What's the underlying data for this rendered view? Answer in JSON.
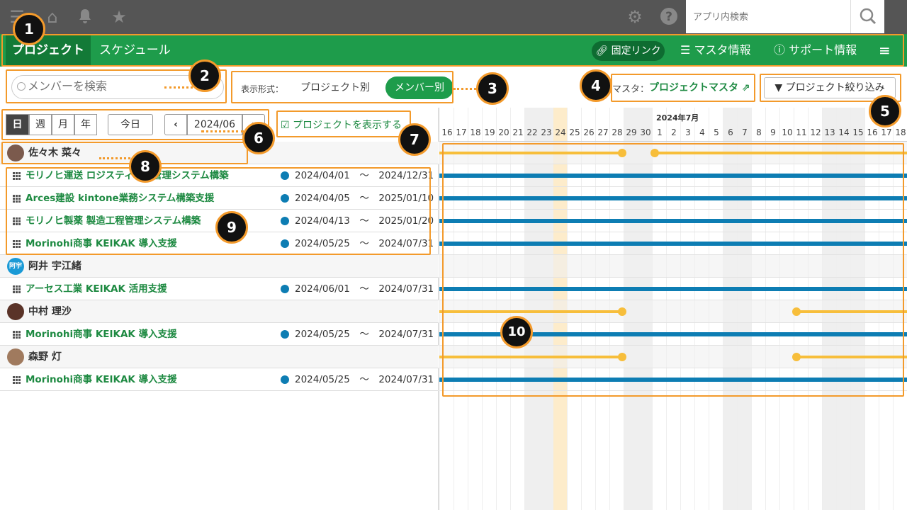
{
  "topbar": {
    "icons": [
      "menu-icon",
      "home-icon",
      "bell-icon",
      "star-icon",
      "gear-icon",
      "help-icon"
    ],
    "search_placeholder": "アプリ内検索"
  },
  "nav": {
    "tabs": [
      "プロジェクト",
      "スケジュール"
    ],
    "fixed_link": "固定リンク",
    "master_info": "マスタ情報",
    "support_info": "サポート情報"
  },
  "toolbar": {
    "member_search_placeholder": "メンバーを検索",
    "display_label": "表示形式：",
    "view_by_project": "プロジェクト別",
    "view_by_member": "メンバー別",
    "master_label": "マスタ：",
    "master_link": "プロジェクトマスタ",
    "filter_button": "プロジェクト絞り込み"
  },
  "period": {
    "day": "日",
    "week": "週",
    "month": "月",
    "year": "年",
    "today": "今日",
    "current": "2024/06",
    "prev": "‹",
    "next": "›",
    "show_projects": "プロジェクトを表示する"
  },
  "gantt": {
    "month_label": "2024年7月",
    "days": [
      "16",
      "17",
      "18",
      "19",
      "20",
      "21",
      "22",
      "23",
      "24",
      "25",
      "26",
      "27",
      "28",
      "29",
      "30",
      "1",
      "2",
      "3",
      "4",
      "5",
      "6",
      "7",
      "8",
      "9",
      "10",
      "11",
      "12",
      "13",
      "14",
      "15",
      "16",
      "17",
      "18"
    ]
  },
  "members": [
    {
      "name": "佐々木 菜々",
      "projects": [
        {
          "name": "モリノヒ運送 ロジスティクス管理システム構築",
          "start": "2024/04/01",
          "end": "2024/12/31"
        },
        {
          "name": "Arces建設 kintone業務システム構築支援",
          "start": "2024/04/05",
          "end": "2025/01/10"
        },
        {
          "name": "モリノヒ製薬 製造工程管理システム構築",
          "start": "2024/04/13",
          "end": "2025/01/20"
        },
        {
          "name": "Morinohi商事 KEIKAK 導入支援",
          "start": "2024/05/25",
          "end": "2024/07/31"
        }
      ]
    },
    {
      "name": "阿井 宇江緒",
      "avatar_text": "阿宇",
      "projects": [
        {
          "name": "アーセス工業 KEIKAK 活用支援",
          "start": "2024/06/01",
          "end": "2024/07/31"
        }
      ]
    },
    {
      "name": "中村 理沙",
      "projects": [
        {
          "name": "Morinohi商事 KEIKAK 導入支援",
          "start": "2024/05/25",
          "end": "2024/07/31"
        }
      ]
    },
    {
      "name": "森野 灯",
      "projects": [
        {
          "name": "Morinohi商事 KEIKAK 導入支援",
          "start": "2024/05/25",
          "end": "2024/07/31"
        }
      ]
    }
  ],
  "tilde": "〜",
  "callouts": [
    "1",
    "2",
    "3",
    "4",
    "5",
    "6",
    "7",
    "8",
    "9",
    "10"
  ],
  "colors": {
    "nav_green": "#1e9c4b",
    "accent_orange": "#f39a2b",
    "bar_blue": "#0d7db3",
    "bar_yellow": "#f7be3b"
  }
}
